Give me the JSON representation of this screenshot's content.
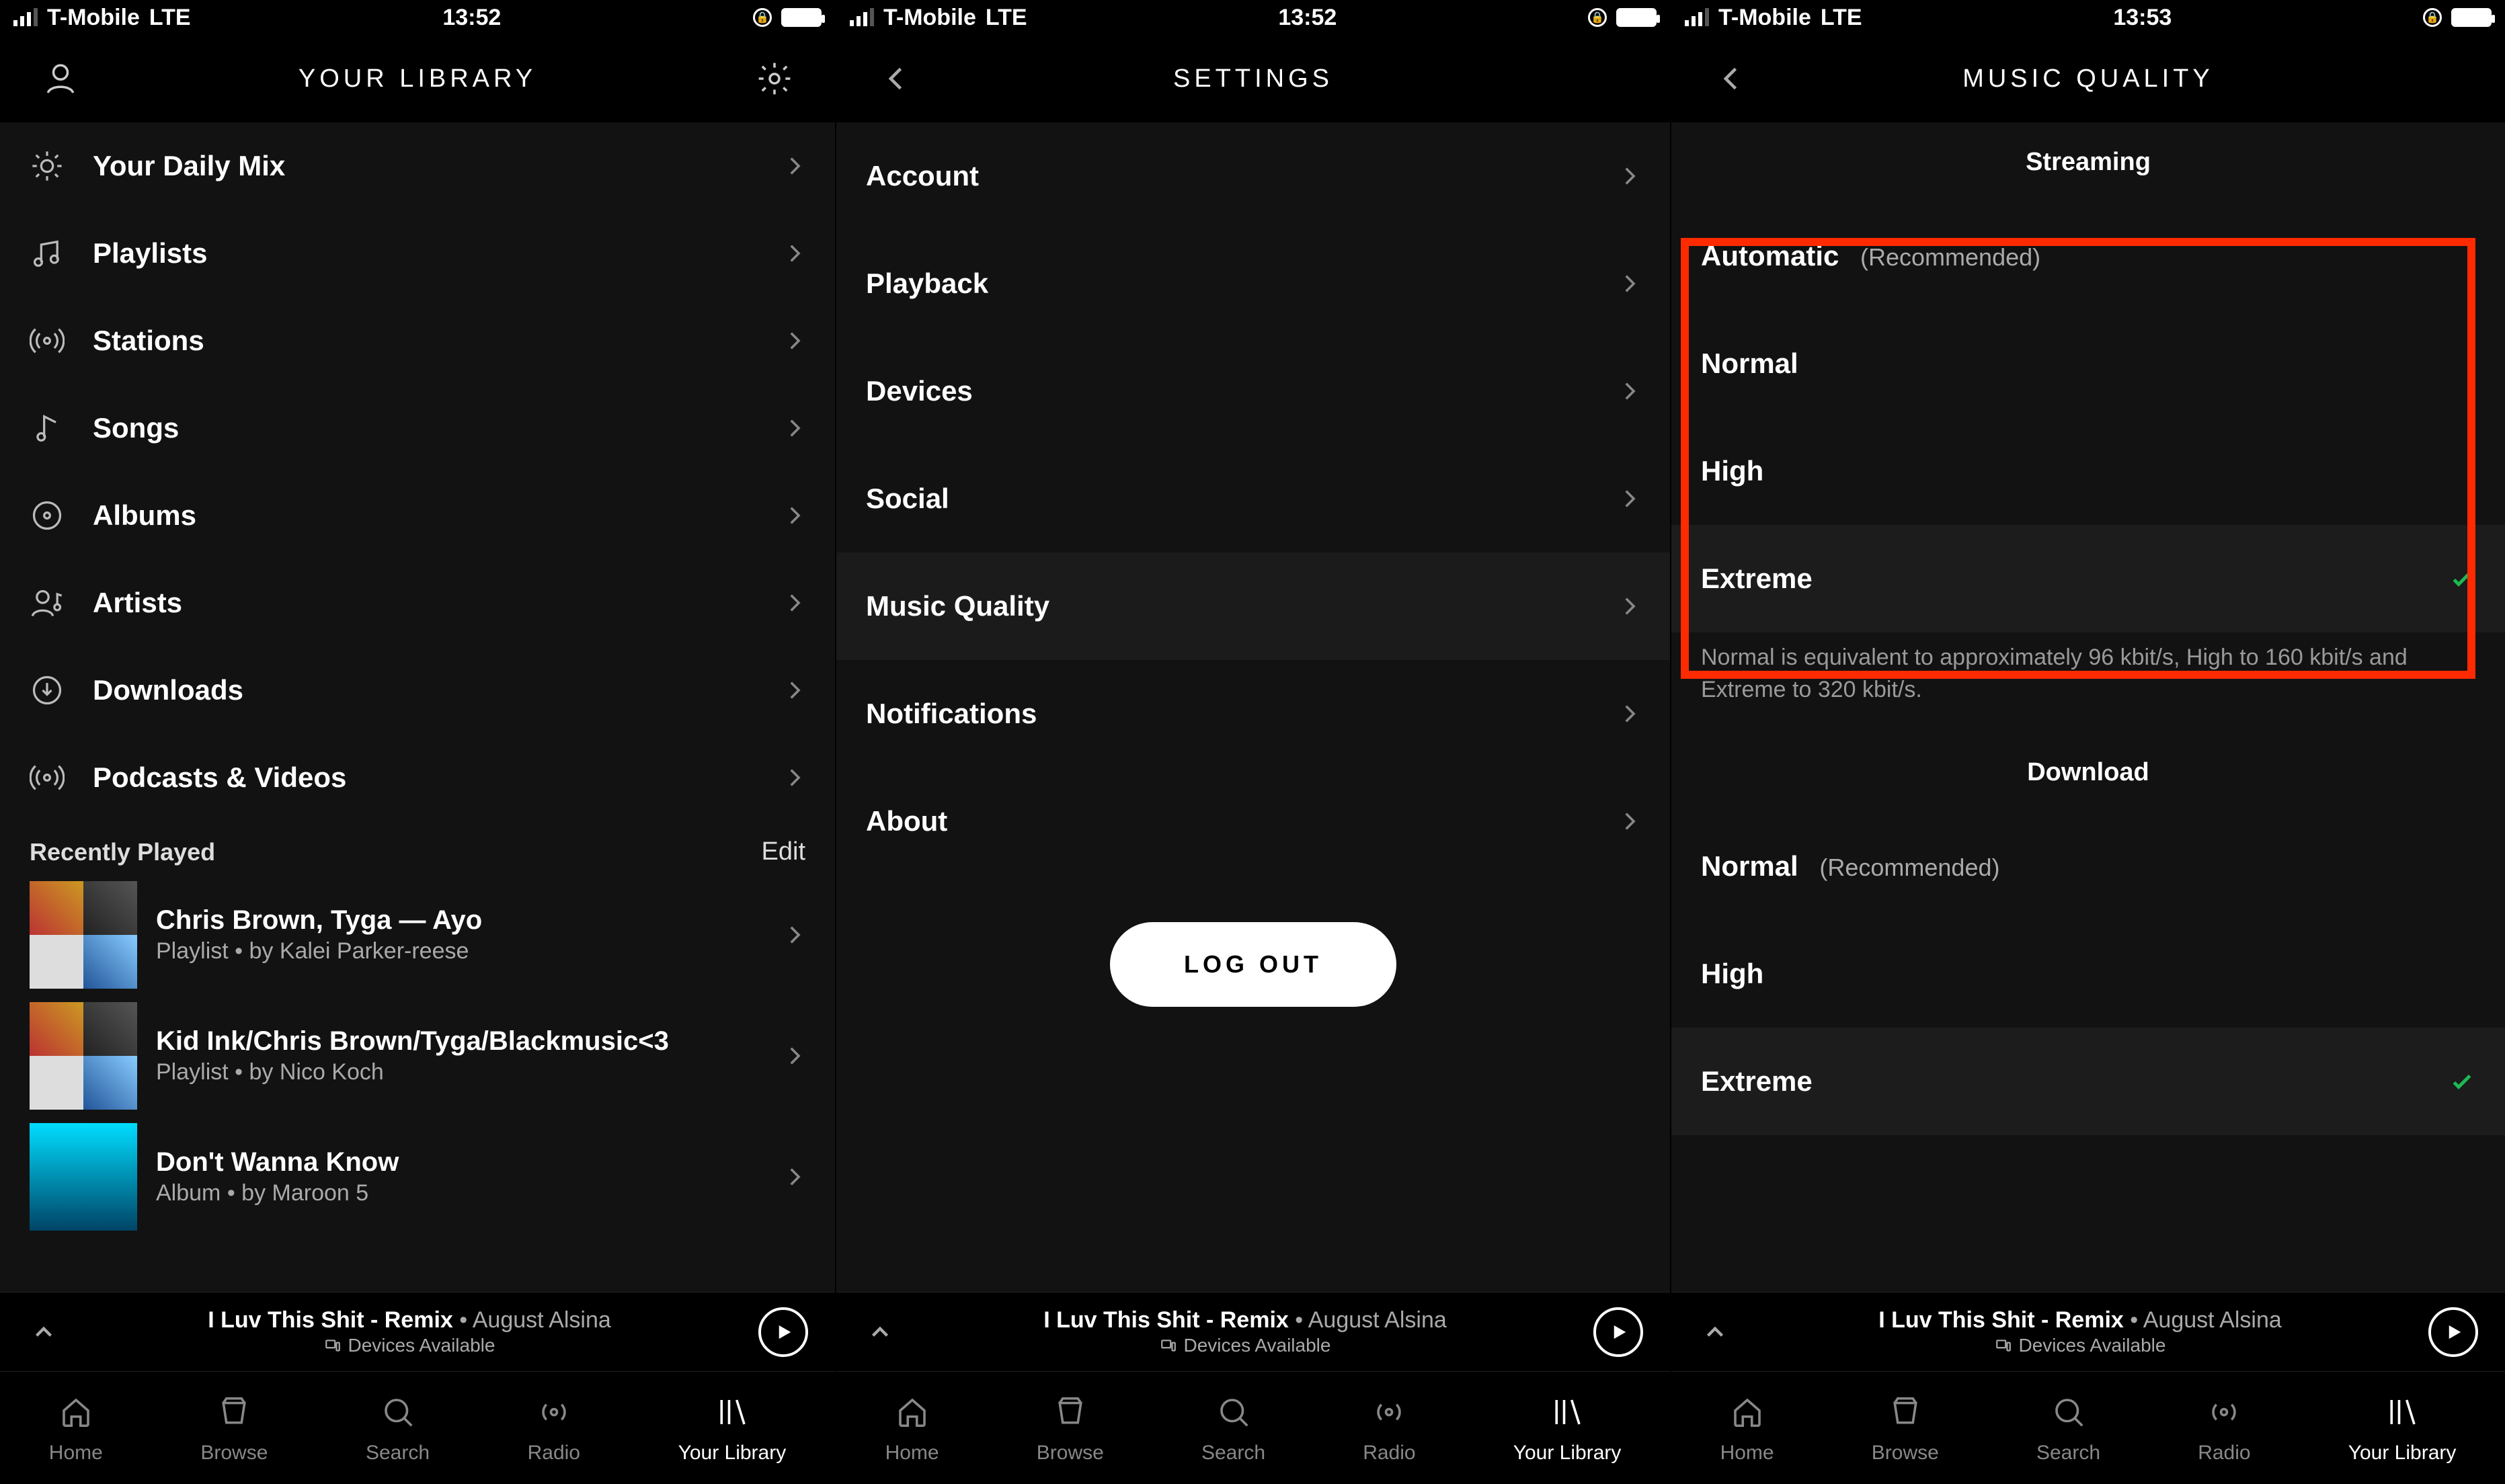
{
  "status": {
    "carrier": "T-Mobile",
    "network": "LTE"
  },
  "times": [
    "13:52",
    "13:52",
    "13:53"
  ],
  "panel1": {
    "title": "YOUR LIBRARY",
    "items": [
      {
        "icon": "sun",
        "label": "Your Daily Mix"
      },
      {
        "icon": "music",
        "label": "Playlists"
      },
      {
        "icon": "radio",
        "label": "Stations"
      },
      {
        "icon": "note",
        "label": "Songs"
      },
      {
        "icon": "disc",
        "label": "Albums"
      },
      {
        "icon": "artist",
        "label": "Artists"
      },
      {
        "icon": "download",
        "label": "Downloads"
      },
      {
        "icon": "podcast",
        "label": "Podcasts & Videos"
      }
    ],
    "recently_label": "Recently Played",
    "edit_label": "Edit",
    "recently": [
      {
        "title": "Chris Brown, Tyga — Ayo",
        "sub": "Playlist • by Kalei Parker-reese",
        "kind": "grid"
      },
      {
        "title": "Kid Ink/Chris Brown/Tyga/Blackmusic<3",
        "sub": "Playlist • by Nico Koch",
        "kind": "grid"
      },
      {
        "title": "Don't Wanna Know",
        "sub": "Album • by Maroon 5",
        "kind": "single"
      }
    ]
  },
  "panel2": {
    "title": "SETTINGS",
    "items": [
      "Account",
      "Playback",
      "Devices",
      "Social",
      "Music Quality",
      "Notifications",
      "About"
    ],
    "logout": "LOG OUT"
  },
  "panel3": {
    "title": "MUSIC QUALITY",
    "streaming_label": "Streaming",
    "streaming": [
      {
        "label": "Automatic",
        "hint": "(Recommended)",
        "checked": false
      },
      {
        "label": "Normal",
        "hint": "",
        "checked": false
      },
      {
        "label": "High",
        "hint": "",
        "checked": false
      },
      {
        "label": "Extreme",
        "hint": "",
        "checked": true
      }
    ],
    "footnote": "Normal is equivalent to approximately 96 kbit/s, High to 160 kbit/s and Extreme to 320 kbit/s.",
    "download_label": "Download",
    "download": [
      {
        "label": "Normal",
        "hint": "(Recommended)",
        "checked": false
      },
      {
        "label": "High",
        "hint": "",
        "checked": false
      },
      {
        "label": "Extreme",
        "hint": "",
        "checked": true
      }
    ]
  },
  "now_playing": {
    "song": "I Luv This Shit - Remix",
    "artist": "August Alsina",
    "devices": "Devices Available"
  },
  "tabs": [
    "Home",
    "Browse",
    "Search",
    "Radio",
    "Your Library"
  ]
}
